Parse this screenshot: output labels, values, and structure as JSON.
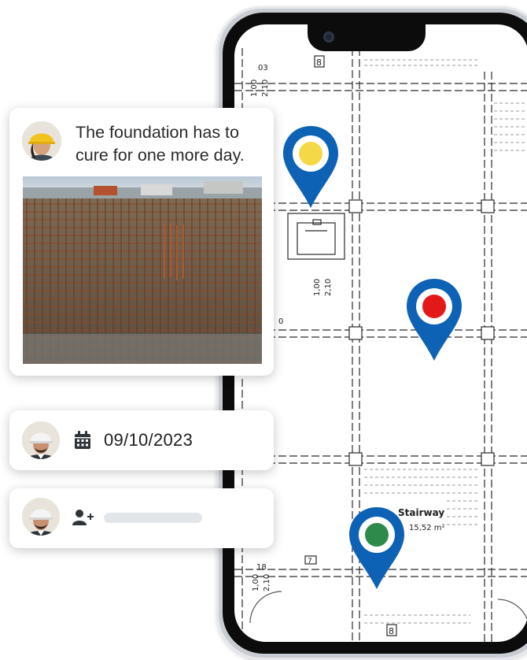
{
  "floor_plan": {
    "room_numbers": [
      "03",
      "8",
      "18",
      "7",
      "8"
    ],
    "dimensions": [
      "1,00",
      "2,10"
    ],
    "partial_value": "0",
    "room": {
      "name": "Stairway",
      "area": "15,52 m²"
    }
  },
  "pins": [
    {
      "status": "yellow",
      "color": "#f5d845"
    },
    {
      "status": "red",
      "color": "#e31919"
    },
    {
      "status": "green",
      "color": "#2e8a4b"
    }
  ],
  "pin_color": "#0e62b5",
  "comment_card": {
    "text": "The foundation has to cure for one more day.",
    "photo_icon": "construction-rebar-photo"
  },
  "date_card": {
    "icon": "calendar-icon",
    "date": "09/10/2023"
  },
  "assign_card": {
    "icon": "add-user-icon",
    "assignee_value": ""
  }
}
